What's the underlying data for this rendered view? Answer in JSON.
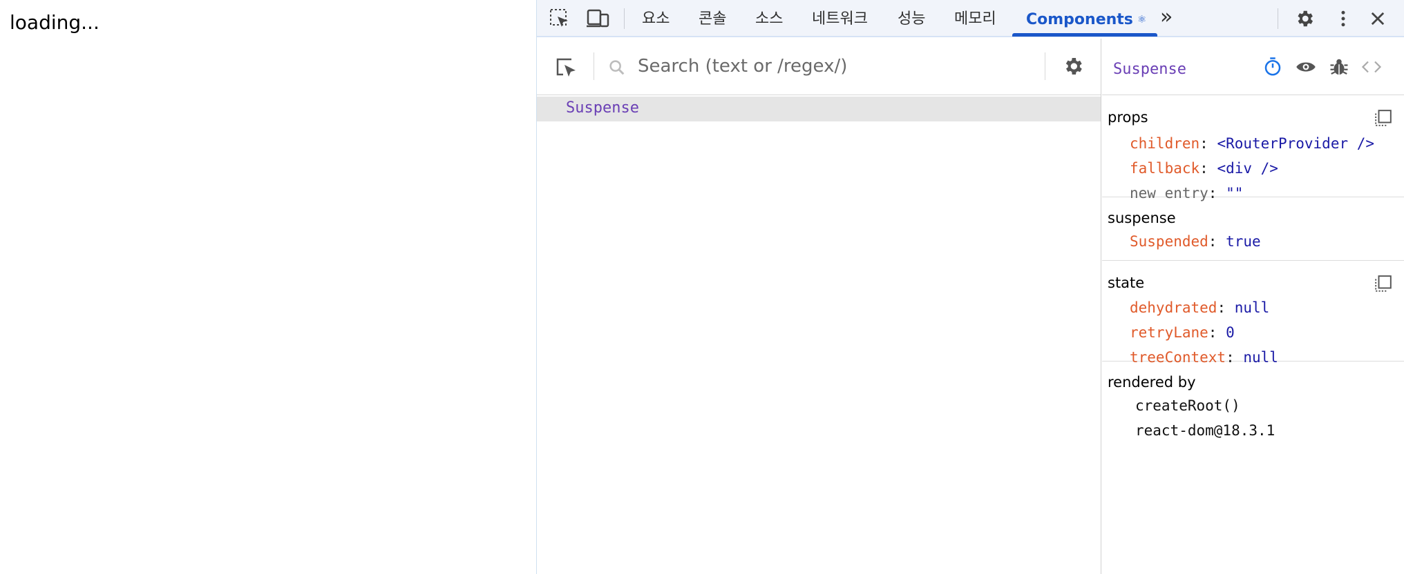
{
  "page": {
    "loading_text": "loading..."
  },
  "devtools": {
    "tabs": [
      {
        "label": "요소"
      },
      {
        "label": "콘솔"
      },
      {
        "label": "소스"
      },
      {
        "label": "네트워크"
      },
      {
        "label": "성능"
      },
      {
        "label": "메모리"
      },
      {
        "label": "Components",
        "active": true,
        "glyph": "⚛"
      }
    ],
    "more_tabs": "»",
    "accent_color": "#1a57c9"
  },
  "tree": {
    "search_placeholder": "Search (text or /regex/)",
    "search_value": "",
    "rows": [
      {
        "label": "Suspense",
        "selected": true
      }
    ]
  },
  "inspector": {
    "component_name": "Suspense",
    "sections": {
      "props": {
        "title": "props",
        "items": [
          {
            "key": "children",
            "value": "<RouterProvider />"
          },
          {
            "key": "fallback",
            "value": "<div />"
          },
          {
            "key": "new entry",
            "value": "\"\""
          }
        ]
      },
      "suspense": {
        "title": "suspense",
        "items": [
          {
            "key": "Suspended",
            "value": "true"
          }
        ]
      },
      "state": {
        "title": "state",
        "items": [
          {
            "key": "dehydrated",
            "value": "null"
          },
          {
            "key": "retryLane",
            "value": "0"
          },
          {
            "key": "treeContext",
            "value": "null"
          }
        ]
      },
      "rendered_by": {
        "title": "rendered by",
        "items": [
          "createRoot()",
          "react-dom@18.3.1"
        ]
      }
    }
  },
  "colors": {
    "component_name": "#6a3fb5",
    "prop_key": "#e05a2a",
    "prop_value": "#1a1aa6"
  }
}
